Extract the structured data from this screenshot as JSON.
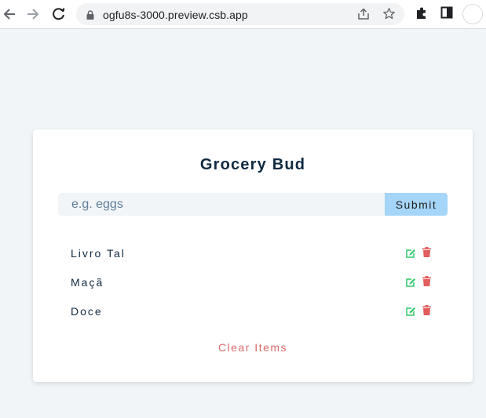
{
  "browser": {
    "url": "ogfu8s-3000.preview.csb.app",
    "icons": [
      "back-arrow-icon",
      "forward-arrow-icon",
      "reload-icon",
      "lock-icon",
      "share-icon",
      "star-icon",
      "extensions-puzzle-icon",
      "side-panel-icon",
      "profile-avatar-icon"
    ]
  },
  "app": {
    "title": "Grocery Bud",
    "input_placeholder": "e.g. eggs",
    "input_value": "",
    "submit_label": "Submit",
    "clear_label": "Clear Items",
    "items": [
      {
        "name": "Livro Tal"
      },
      {
        "name": "Maçã"
      },
      {
        "name": "Doce"
      }
    ]
  },
  "colors": {
    "background": "#f1f5f8",
    "title": "#102a42",
    "submit_bg": "#a5d5f8",
    "edit_icon": "#2ec76a",
    "delete_icon": "#e35d5d",
    "clear_text": "#d96a6a"
  }
}
